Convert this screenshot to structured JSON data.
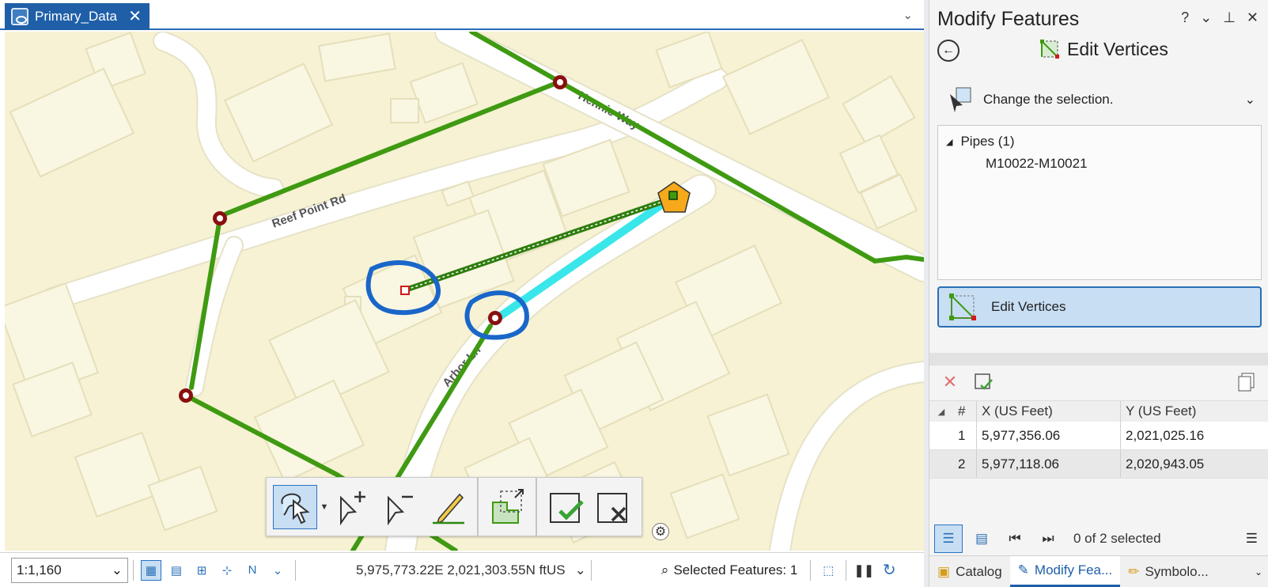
{
  "map": {
    "tab_title": "Primary_Data",
    "close_glyph": "✕",
    "menu_glyph": "⌄",
    "street_labels": [
      "Reef Point Rd",
      "Arbor Ln",
      "Hennie Way"
    ],
    "colors": {
      "background": "#f6f2d3",
      "building": "#f9f6e2",
      "road": "#ffffff",
      "pipe": "#3f9a12",
      "selected_segment": "#39e6ea",
      "highlight_circle": "#1a66c9",
      "manhole": "#8a0f10",
      "vertex": "#d11a1a",
      "junction": "#f5a91b"
    }
  },
  "statusbar": {
    "scale": "1:1,160",
    "coordinates": "5,975,773.22E 2,021,303.55N ftUS",
    "selected_features": "Selected Features: 1"
  },
  "panel": {
    "title": "Modify Features",
    "controls": [
      "?",
      "⌄",
      "⊥",
      "✕"
    ],
    "tool_heading": "Edit Vertices",
    "change_selection": "Change the selection.",
    "selection_tree": {
      "layer": "Pipes (1)",
      "feature": "M10022-M10021"
    },
    "edit_vertices_button": "Edit Vertices",
    "vertex_grid": {
      "columns": [
        "#",
        "X (US Feet)",
        "Y (US Feet)"
      ],
      "rows": [
        {
          "num": "1",
          "x": "5,977,356.06",
          "y": "2,021,025.16"
        },
        {
          "num": "2",
          "x": "5,977,118.06",
          "y": "2,020,943.05"
        }
      ]
    },
    "selection_count": "0 of 2 selected",
    "bottom_tabs": [
      "Catalog",
      "Modify Fea...",
      "Symbolo..."
    ]
  }
}
